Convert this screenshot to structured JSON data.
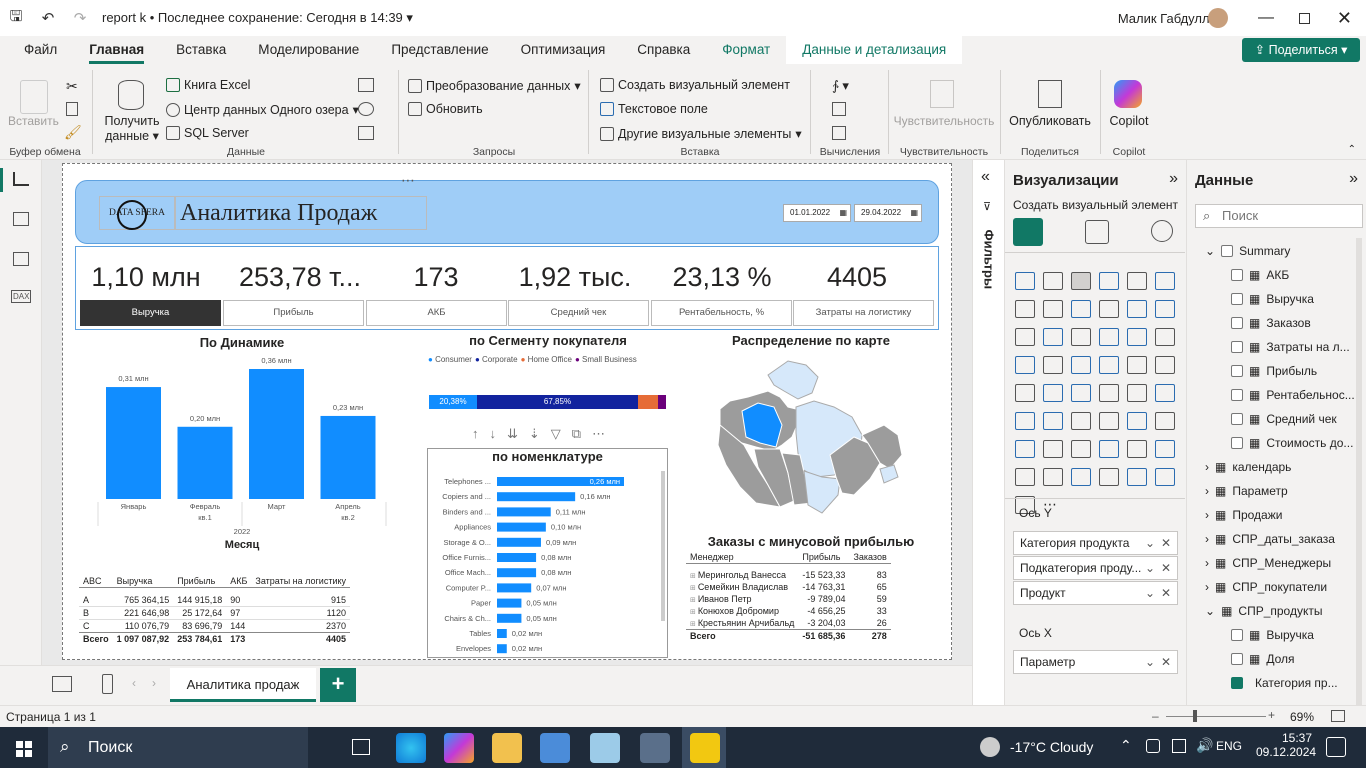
{
  "titlebar": {
    "doc_title": "report k",
    "save_status": "Последнее сохранение: Сегодня в 14:39",
    "user": "Малик Габдуллин"
  },
  "menu": {
    "tabs": [
      "Файл",
      "Главная",
      "Вставка",
      "Моделирование",
      "Представление",
      "Оптимизация",
      "Справка",
      "Формат",
      "Данные и детализация"
    ],
    "share": "Поделиться"
  },
  "ribbon": {
    "clipboard": {
      "paste": "Вставить",
      "label": "Буфер обмена"
    },
    "data": {
      "get_data": "Получить",
      "get_data2": "данные",
      "excel": "Книга Excel",
      "onelake": "Центр данных Одного озера",
      "sql": "SQL Server",
      "label": "Данные"
    },
    "queries": {
      "transform": "Преобразование данных",
      "refresh": "Обновить",
      "label": "Запросы"
    },
    "insert": {
      "new_visual": "Создать визуальный элемент",
      "textbox": "Текстовое поле",
      "more_visuals": "Другие визуальные элементы",
      "label": "Вставка"
    },
    "calc": {
      "label": "Вычисления"
    },
    "sensitivity": {
      "btn": "Чувствительность",
      "label": "Чувствительность"
    },
    "share": {
      "publish": "Опубликовать",
      "label": "Поделиться"
    },
    "copilot": {
      "btn": "Copilot",
      "label": "Copilot"
    }
  },
  "report": {
    "logo": "DATA SFERA",
    "title": "Аналитика Продаж",
    "date_from": "01.01.2022",
    "date_to": "29.04.2022",
    "kpis": [
      {
        "value": "1,10 млн",
        "label": "Выручка"
      },
      {
        "value": "253,78 т...",
        "label": "Прибыль"
      },
      {
        "value": "173",
        "label": "АКБ"
      },
      {
        "value": "1,92 тыс.",
        "label": "Средний чек"
      },
      {
        "value": "23,13 %",
        "label": "Рентабельность, %"
      },
      {
        "value": "4405",
        "label": "Затраты на логистику"
      }
    ],
    "dyn": {
      "title": "По Динамике",
      "year": "2022",
      "xtitle": "Месяц"
    },
    "segment": {
      "title": "по Сегменту покупателя",
      "legend": [
        "Consumer",
        "Corporate",
        "Home Office",
        "Small Business"
      ],
      "colors": [
        "#118dff",
        "#12239e",
        "#e66c37",
        "#6b007b"
      ],
      "p1": "20,38%",
      "p2": "67,85%"
    },
    "nomen": {
      "title": "по номенклатуре"
    },
    "map": {
      "title": "Распределение по карте"
    },
    "abc": {
      "headers": [
        "ABC",
        "Выручка",
        "Прибыль",
        "АКБ",
        "Затраты на логистику"
      ],
      "rows": [
        [
          "A",
          "765 364,15",
          "144 915,18",
          "90",
          "915"
        ],
        [
          "B",
          "221 646,98",
          "25 172,64",
          "97",
          "1120"
        ],
        [
          "C",
          "110 076,79",
          "83 696,79",
          "144",
          "2370"
        ]
      ],
      "total": [
        "Всего",
        "1 097 087,92",
        "253 784,61",
        "173",
        "4405"
      ]
    },
    "neg": {
      "title": "Заказы с минусовой прибылью",
      "headers": [
        "Менеджер",
        "Прибыль",
        "Заказов"
      ],
      "rows": [
        [
          "Мерингольд Ванесса",
          "-15 523,33",
          "83"
        ],
        [
          "Семейкин Владислав",
          "-14 763,31",
          "65"
        ],
        [
          "Иванов Петр",
          "-9 789,04",
          "59"
        ],
        [
          "Конюхов Добромир",
          "-4 656,25",
          "33"
        ],
        [
          "Крестьянин Арчибальд",
          "-3 204,03",
          "26"
        ]
      ],
      "total": [
        "Всего",
        "-51 685,36",
        "278"
      ]
    }
  },
  "chart_data": [
    {
      "type": "bar",
      "title": "По Динамике",
      "categories": [
        "Январь",
        "Февраль",
        "Март",
        "Апрель"
      ],
      "subcategories": [
        "",
        "кв.1",
        "",
        "кв.2"
      ],
      "values": [
        0.31,
        0.2,
        0.36,
        0.23
      ],
      "labels": [
        "0,31 млн",
        "0,20 млн",
        "0,36 млн",
        "0,23 млн"
      ],
      "xlabel": "Месяц",
      "color": "#118dff"
    },
    {
      "type": "bar",
      "title": "по номенклатуре",
      "orientation": "horizontal",
      "categories": [
        "Telephones ...",
        "Copiers and ...",
        "Binders and ...",
        "Appliances",
        "Storage & O...",
        "Office Furnis...",
        "Office Mach...",
        "Computer P...",
        "Paper",
        "Chairs & Ch...",
        "Tables",
        "Envelopes"
      ],
      "values": [
        0.26,
        0.16,
        0.11,
        0.1,
        0.09,
        0.08,
        0.08,
        0.07,
        0.05,
        0.05,
        0.02,
        0.02
      ],
      "labels": [
        "0,26 млн",
        "0,16 млн",
        "0,11 млн",
        "0,10 млн",
        "0,09 млн",
        "0,08 млн",
        "0,08 млн",
        "0,07 млн",
        "0,05 млн",
        "0,05 млн",
        "0,02 млн",
        "0,02 млн"
      ],
      "color": "#118dff"
    }
  ],
  "viz": {
    "title": "Визуализации",
    "build": "Создать визуальный элемент",
    "axisY": "Ось Y",
    "wellsY": [
      "Категория продукта",
      "Подкатегория проду...",
      "Продукт"
    ],
    "axisX": "Ось X",
    "wellsX": [
      "Параметр"
    ],
    "filters": "Фильтры"
  },
  "data_pane": {
    "title": "Данные",
    "search": "Поиск",
    "summary": "Summary",
    "fields": [
      "АКБ",
      "Выручка",
      "Заказов",
      "Затраты на л...",
      "Прибыль",
      "Рентабельнос...",
      "Средний чек",
      "Стоимость до..."
    ],
    "tables": [
      "календарь",
      "Параметр",
      "Продажи",
      "СПР_даты_заказа",
      "СПР_Менеджеры",
      "СПР_покупатели",
      "СПР_продукты"
    ],
    "prod_fields": [
      "Выручка",
      "Доля",
      "Категория пр..."
    ]
  },
  "pagetab": "Аналитика продаж",
  "status": {
    "page": "Страница 1 из 1",
    "zoom": "69%"
  },
  "taskbar": {
    "search": "Поиск",
    "weather": "-17°C  Cloudy",
    "lang": "ENG",
    "time": "15:37",
    "date": "09.12.2024"
  }
}
